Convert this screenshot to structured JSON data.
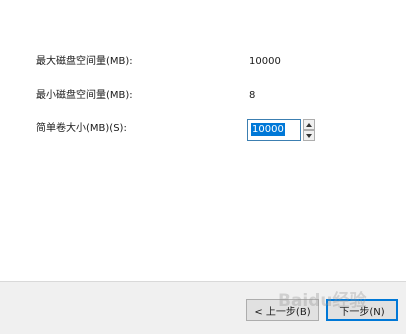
{
  "fields": {
    "max_space_label": "最大磁盘空间量(MB):",
    "max_space_value": "10000",
    "min_space_label": "最小磁盘空间量(MB):",
    "min_space_value": "8",
    "volume_size_label": "简单卷大小(MB)(S):",
    "volume_size_value": "10000"
  },
  "footer": {
    "back_label": "< 上一步(B)",
    "next_label": "下一步(N)"
  },
  "watermark": {
    "text": "Baidu经验"
  },
  "colors": {
    "selection": "#0078d7",
    "footer_bg": "#f0f0f0",
    "focus_border": "#0078d7"
  },
  "icons": {
    "spin_up": "spin-up-arrow-icon",
    "spin_down": "spin-down-arrow-icon"
  }
}
